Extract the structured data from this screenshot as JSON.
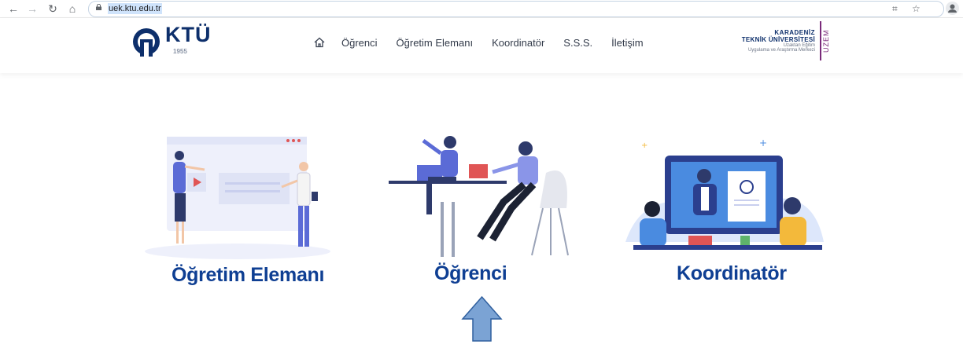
{
  "browser": {
    "url": "uek.ktu.edu.tr",
    "icons": [
      "back-icon",
      "forward-icon",
      "reload-icon",
      "home-icon",
      "lock-icon",
      "qr-icon",
      "star-icon",
      "profile-icon"
    ]
  },
  "header": {
    "logo_text": "KTÜ",
    "logo_year": "1955",
    "nav": {
      "items": [
        "Öğrenci",
        "Öğretim Elemanı",
        "Koordinatör",
        "S.S.S.",
        "İletişim"
      ]
    },
    "university": {
      "line1": "KARADENİZ",
      "line2": "TEKNİK ÜNİVERSİTESİ",
      "line3": "Uzaktan Eğitim",
      "line4": "Uygulama ve Araştırma Merkezi",
      "unit": "UZEM"
    },
    "colors": {
      "brand": "#0d2f6b",
      "uzem": "#7a2a7a"
    }
  },
  "cards": [
    {
      "title": "Öğretim Elemanı"
    },
    {
      "title": "Öğrenci"
    },
    {
      "title": "Koordinatör"
    }
  ],
  "colors": {
    "card_title": "#0f3f93",
    "arrow": "#7ba3d4",
    "arrow_stroke": "#2f5f9e",
    "illustration_primary": "#5b6bd6"
  }
}
